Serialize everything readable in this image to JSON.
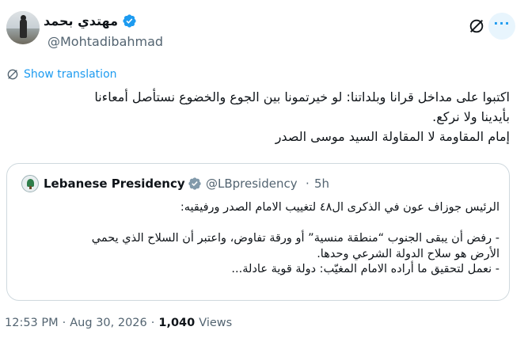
{
  "author": {
    "display_name": "مهتدي بحمد",
    "handle": "@Mohtadibahmad",
    "avatar_icon": "avatar-photo",
    "verified_icon": "verified-badge-icon"
  },
  "header_actions": {
    "grok_icon": "grok-icon",
    "more_label": "···"
  },
  "translate": {
    "label": "Show translation",
    "icon": "globe-icon"
  },
  "tweet": {
    "lines": [
      "اكتبوا على مداخل قرانا وبلداتنا: لو خيرتمونا بين الجوع والخضوع نستأصل أمعاءنا",
      "بأيدينا ولا نركع.",
      "إمام المقاومة لا المقاولة السيد موسى الصدر"
    ]
  },
  "quote": {
    "name": "Lebanese Presidency",
    "handle": "@LBpresidency",
    "dot": "·",
    "time": "5h",
    "logo_icon": "cedar-logo-icon",
    "lines": [
      "الرئيس جوزاف عون في الذكرى ال٤٨ لتغييب الامام الصدر ورفيقيه:",
      "",
      "- رفض أن يبقى الجنوب “منطقة منسية” أو ورقة تفاوض، واعتبر أن السلاح الذي يحمي",
      "الأرض هو سلاح الدولة الشرعي وحدها.",
      "- نعمل لتحقيق ما أراده الامام المغيّب: دولة قوية عادلة..."
    ]
  },
  "footer": {
    "time": "12:53 PM",
    "separator": "·",
    "date": "Aug 30, 2026",
    "views_count": "1,040",
    "views_label": "Views"
  },
  "colors": {
    "accent": "#1d9bf0",
    "muted": "#536471",
    "text": "#0f1419",
    "border": "#cfd9de"
  }
}
